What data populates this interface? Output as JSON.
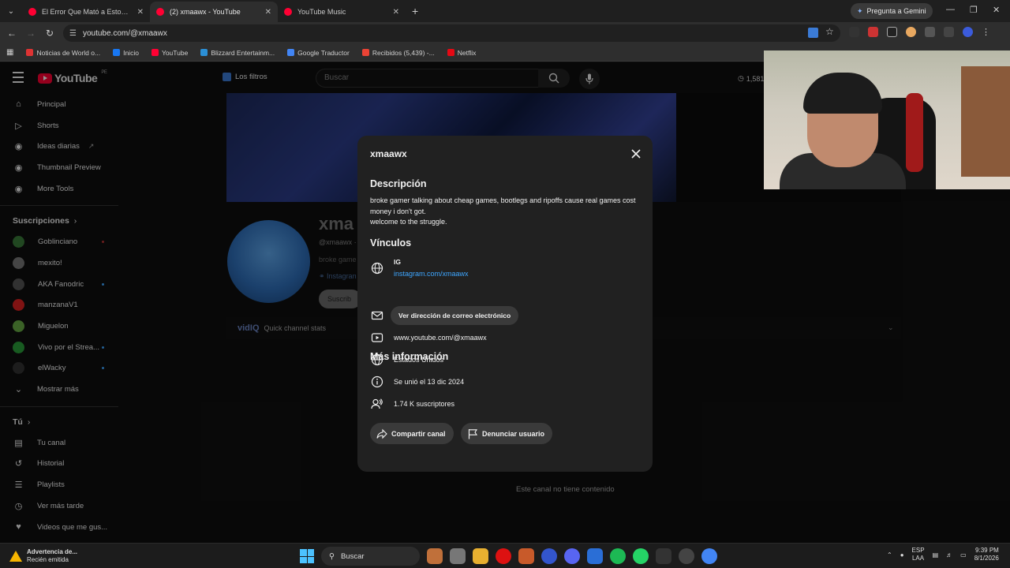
{
  "browser": {
    "tabs": [
      {
        "title": "El Error Que Mató a Estos Batt",
        "active": false
      },
      {
        "title": "(2) xmaawx - YouTube",
        "active": true
      },
      {
        "title": "YouTube Music",
        "active": false
      }
    ],
    "gemini_label": "Pregunta a Gemini",
    "url": "youtube.com/@xmaawx",
    "bookmarks": [
      {
        "label": "Noticias de World o...",
        "color": "#d33"
      },
      {
        "label": "Inicio",
        "color": "#1877f2"
      },
      {
        "label": "YouTube",
        "color": "#ff0033"
      },
      {
        "label": "Blizzard Entertainm...",
        "color": "#2b8fd6"
      },
      {
        "label": "Google Traductor",
        "color": "#4285f4"
      },
      {
        "label": "Recibidos (5,439) -...",
        "color": "#ea4335"
      },
      {
        "label": "Netflix",
        "color": "#e50914"
      }
    ]
  },
  "youtube": {
    "logo_text": "YouTube",
    "region": "PE",
    "filters_label": "Los filtros",
    "search_placeholder": "Buscar",
    "watch_count": "1,581",
    "sidebar": {
      "main": [
        {
          "label": "Principal",
          "icon": "home-icon"
        },
        {
          "label": "Shorts",
          "icon": "shorts-icon"
        },
        {
          "label": "Ideas diarias",
          "icon": "ideas-icon"
        },
        {
          "label": "Thumbnail Preview",
          "icon": "thumbnail-icon"
        },
        {
          "label": "More Tools",
          "icon": "tools-icon"
        }
      ],
      "subscriptions_title": "Suscripciones",
      "subscriptions": [
        {
          "label": "Goblinciano",
          "color": "#3a7a3a"
        },
        {
          "label": "mexito!",
          "color": "#777"
        },
        {
          "label": "AKA Fanodric",
          "color": "#555"
        },
        {
          "label": "manzanaV1",
          "color": "#d22"
        },
        {
          "label": "Miguelon",
          "color": "#6a4"
        },
        {
          "label": "Vivo por el Strea...",
          "color": "#2a9d3a"
        },
        {
          "label": "elWacky",
          "color": "#333"
        }
      ],
      "show_more": "Mostrar más",
      "you_title": "Tú",
      "you": [
        {
          "label": "Tu canal",
          "icon": "channel-icon"
        },
        {
          "label": "Historial",
          "icon": "history-icon"
        },
        {
          "label": "Playlists",
          "icon": "playlists-icon"
        },
        {
          "label": "Ver más tarde",
          "icon": "watch-later-icon"
        },
        {
          "label": "Videos que me gus...",
          "icon": "liked-icon"
        }
      ]
    },
    "channel": {
      "name_partial": "xma",
      "handle": "@xmaawx ·",
      "desc_partial": "broke game",
      "link_partial": "Instagran",
      "subscribe_partial": "Suscrib",
      "vidiq_brand": "vidIQ",
      "vidiq_label": "Quick channel stats",
      "no_content": "Este canal no tiene contenido"
    }
  },
  "dialog": {
    "title": "xmaawx",
    "description_heading": "Descripción",
    "description_line1": "broke gamer talking about cheap games, bootlegs and ripoffs cause real games cost money i don't got.",
    "description_line2": "welcome to the struggle.",
    "links_heading": "Vínculos",
    "link_title": "IG",
    "link_url": "instagram.com/xmaawx",
    "more_info_heading": "Más información",
    "email_button": "Ver dirección de correo electrónico",
    "channel_url": "www.youtube.com/@xmaawx",
    "country": "Estados Unidos",
    "joined": "Se unió el 13 dic 2024",
    "subscribers": "1.74 K suscriptores",
    "share_button": "Compartir canal",
    "report_button": "Denunciar usuario"
  },
  "taskbar": {
    "warning_title": "Advertencia de...",
    "warning_sub": "Recién emitida",
    "search_label": "Buscar",
    "lang_line1": "ESP",
    "lang_line2": "LAA",
    "time": "9:39 PM",
    "date": "8/1/2026"
  }
}
